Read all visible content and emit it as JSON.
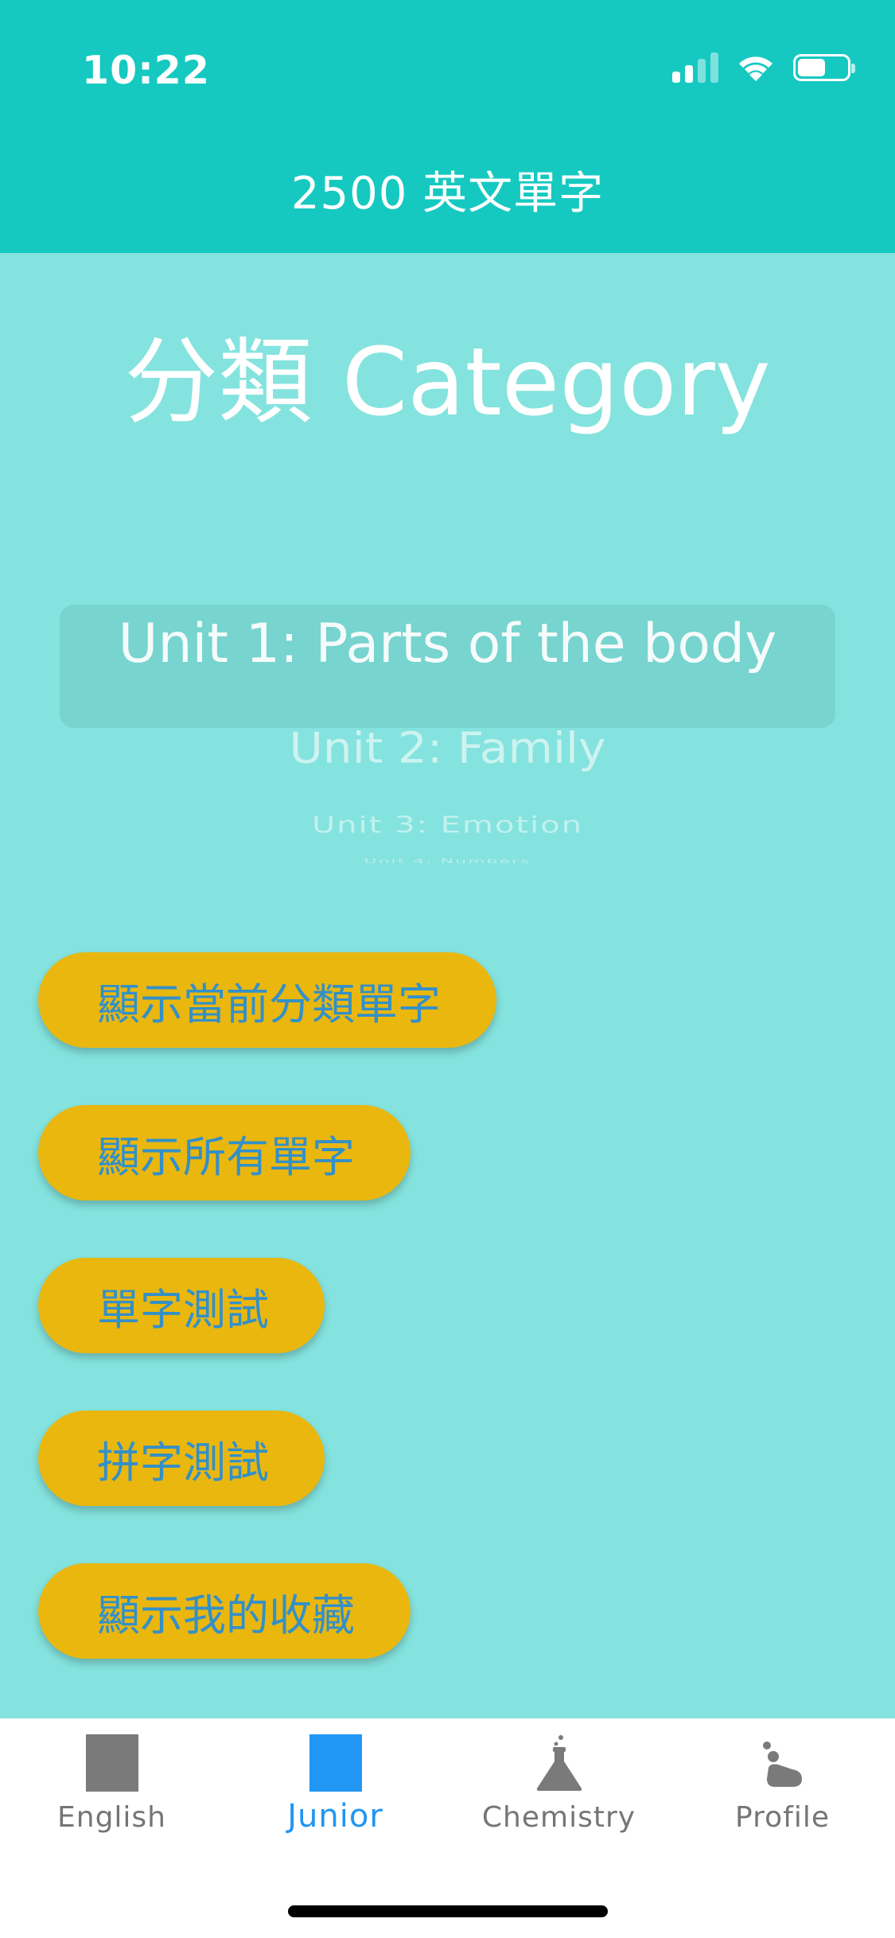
{
  "status_bar": {
    "time": "10:22",
    "icons": [
      "cellular-signal-icon",
      "wifi-icon",
      "battery-icon"
    ]
  },
  "header": {
    "title": "2500 英文單字"
  },
  "category": {
    "title": "分類 Category"
  },
  "picker": {
    "items": [
      "Unit 1: Parts of the body",
      "Unit 2: Family",
      "Unit 3: Emotion",
      "Unit 4: Numbers"
    ],
    "selected_index": 0
  },
  "actions": {
    "show_category_words": "顯示當前分類單字",
    "show_all_words": "顯示所有單字",
    "vocabulary_quiz": "單字測試",
    "spelling_quiz": "拼字測試",
    "show_favorites": "顯示我的收藏"
  },
  "tabs": [
    {
      "label": "English",
      "icon": "square-icon",
      "active": false
    },
    {
      "label": "Junior",
      "icon": "square-icon",
      "active": true
    },
    {
      "label": "Chemistry",
      "icon": "flask-icon",
      "active": false
    },
    {
      "label": "Profile",
      "icon": "profile-icon",
      "active": false
    }
  ],
  "colors": {
    "header_bg": "#15c9c1",
    "page_bg": "#84e3de",
    "button_bg": "#eab70f",
    "button_text": "#3390c8",
    "tab_active": "#2196f3",
    "tab_inactive": "#757575"
  }
}
